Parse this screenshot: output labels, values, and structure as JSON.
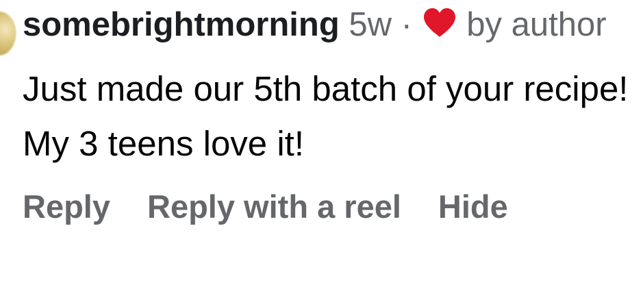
{
  "comment": {
    "username": "somebrightmorning",
    "time": "5w",
    "separator": "·",
    "liked_by": "by",
    "liked_by_who": "author",
    "text": "Just made our 5th batch of your recipe! My 3 teens love it!",
    "heart_icon": "heart-icon",
    "heart_color": "#e0162b"
  },
  "actions": {
    "reply": "Reply",
    "reply_reel": "Reply with a reel",
    "hide": "Hide"
  }
}
